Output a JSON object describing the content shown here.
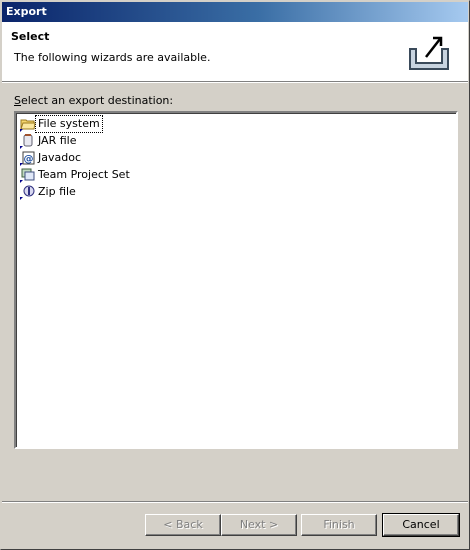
{
  "window": {
    "title": "Export"
  },
  "header": {
    "title": "Select",
    "description": "The following wizards are available.",
    "image_icon": "export-wizard-icon"
  },
  "list": {
    "label_prefix": "S",
    "label_rest": "elect an export destination:",
    "items": [
      {
        "label": "File system",
        "icon": "folder-icon",
        "selected": true
      },
      {
        "label": "JAR file",
        "icon": "jar-icon",
        "selected": false
      },
      {
        "label": "Javadoc",
        "icon": "javadoc-icon",
        "selected": false
      },
      {
        "label": "Team Project Set",
        "icon": "team-project-icon",
        "selected": false
      },
      {
        "label": "Zip file",
        "icon": "zip-icon",
        "selected": false
      }
    ]
  },
  "buttons": {
    "back": "< Back",
    "next": "Next >",
    "finish": "Finish",
    "cancel": "Cancel"
  }
}
